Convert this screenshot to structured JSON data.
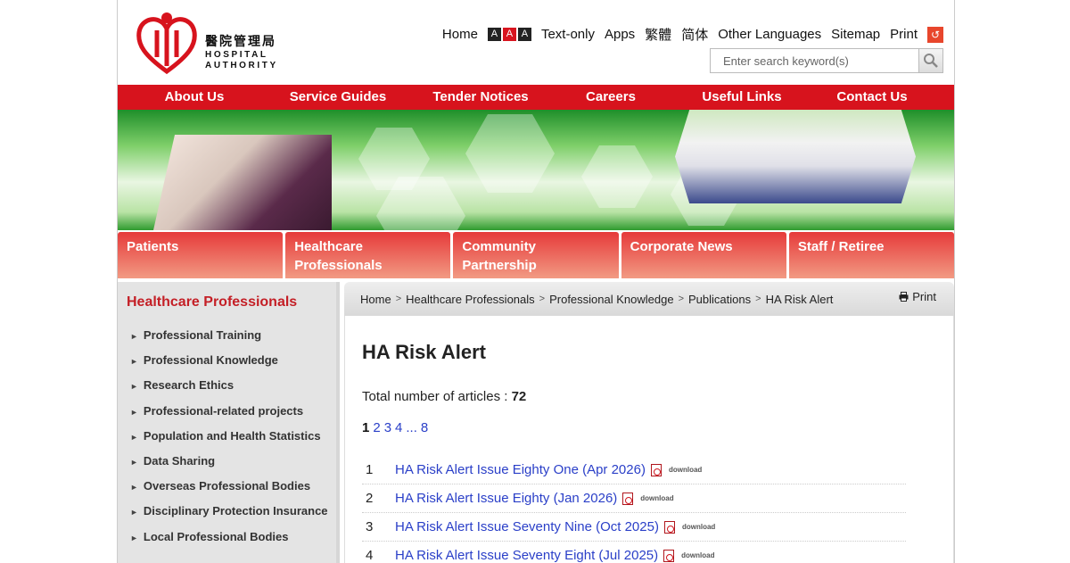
{
  "header": {
    "logo_zh": "醫院管理局",
    "logo_en_1": "HOSPITAL",
    "logo_en_2": "AUTHORITY",
    "top_links": {
      "home": "Home",
      "text_only": "Text-only",
      "apps": "Apps",
      "trad_chinese": "繁體",
      "simp_chinese": "简体",
      "other_languages": "Other Languages",
      "sitemap": "Sitemap",
      "print": "Print"
    },
    "font_sizes": [
      "A",
      "A",
      "A"
    ],
    "search_placeholder": "Enter search keyword(s)"
  },
  "main_nav": [
    "About Us",
    "Service Guides",
    "Tender Notices",
    "Careers",
    "Useful Links",
    "Contact Us"
  ],
  "categories": [
    "Patients",
    "Healthcare Professionals",
    "Community Partnership",
    "Corporate News",
    "Staff / Retiree"
  ],
  "sidebar": {
    "title": "Healthcare Professionals",
    "items": [
      "Professional Training",
      "Professional Knowledge",
      "Research Ethics",
      "Professional-related projects",
      "Population and Health Statistics",
      "Data Sharing",
      "Overseas Professional Bodies",
      "Disciplinary Protection Insurance",
      "Local Professional Bodies"
    ]
  },
  "breadcrumb": [
    "Home",
    "Healthcare Professionals",
    "Professional Knowledge",
    "Publications",
    "HA Risk Alert"
  ],
  "print_label": "Print",
  "content": {
    "title": "HA Risk Alert",
    "total_label": "Total number of articles :",
    "total_count": "72",
    "pages": {
      "current": "1",
      "others": [
        "2",
        "3",
        "4"
      ],
      "ellipsis": "...",
      "last": "8"
    },
    "download_label": "download",
    "articles": [
      {
        "num": "1",
        "title": "HA Risk Alert Issue Eighty One (Apr 2026)"
      },
      {
        "num": "2",
        "title": "HA Risk Alert Issue Eighty (Jan 2026)"
      },
      {
        "num": "3",
        "title": "HA Risk Alert Issue Seventy Nine (Oct 2025)"
      },
      {
        "num": "4",
        "title": "HA Risk Alert Issue Seventy Eight (Jul 2025)"
      }
    ]
  },
  "colors": {
    "brand_red": "#d7131d",
    "link_blue": "#2a3fc8",
    "sidebar_title": "#c41f26"
  }
}
